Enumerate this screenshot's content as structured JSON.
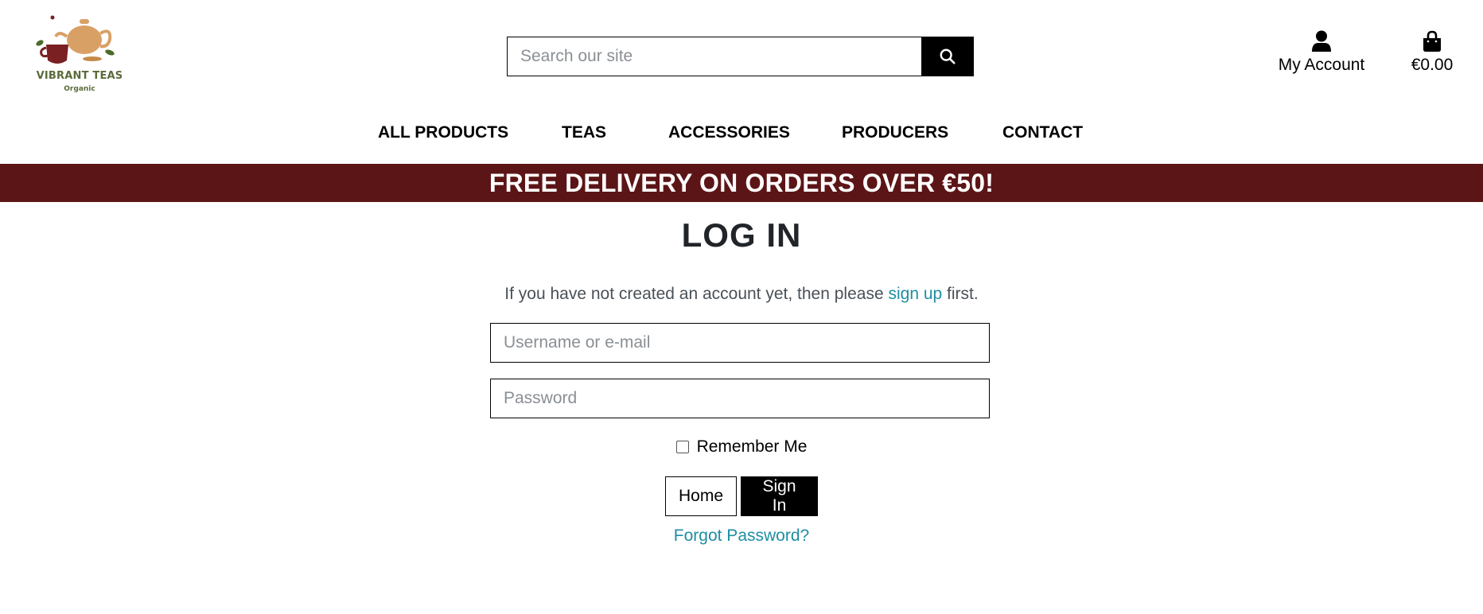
{
  "brand": {
    "name": "VIBRANT TEAS",
    "tagline": "Organic",
    "colors": {
      "banner": "#5c1516",
      "link": "#1d8ea3",
      "logo_green": "#5a6b3a",
      "teapot": "#d9a066",
      "cup": "#7a1f22"
    }
  },
  "header": {
    "search": {
      "placeholder": "Search our site",
      "value": "",
      "icon": "search-icon"
    },
    "account": {
      "label": "My Account",
      "icon": "user-icon"
    },
    "cart": {
      "total": "€0.00",
      "icon": "shopping-bag-icon"
    }
  },
  "nav": {
    "items": [
      {
        "label": "ALL PRODUCTS"
      },
      {
        "label": "TEAS"
      },
      {
        "label": "ACCESSORIES"
      },
      {
        "label": "PRODUCERS"
      },
      {
        "label": "CONTACT"
      }
    ]
  },
  "banner": {
    "text": "FREE DELIVERY ON ORDERS OVER €50!"
  },
  "login": {
    "title": "LOG IN",
    "intro_before": "If you have not created an account yet, then please ",
    "intro_link": "sign up",
    "intro_after": " first.",
    "username_placeholder": "Username or e-mail",
    "password_placeholder": "Password",
    "remember_label": "Remember Me",
    "remember_checked": false,
    "home_button": "Home",
    "signin_button": "Sign In",
    "forgot_link": "Forgot Password?"
  }
}
